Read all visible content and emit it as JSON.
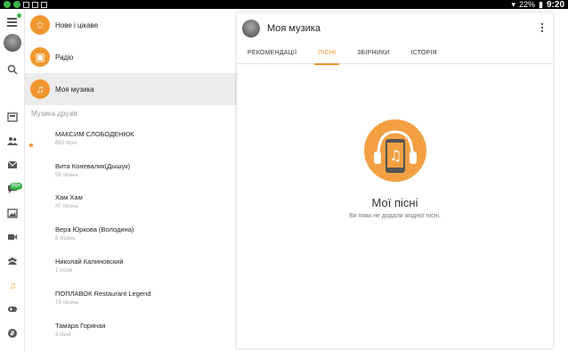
{
  "status_bar": {
    "battery": "22%",
    "time": "9:20"
  },
  "rail": {
    "icons": [
      "menu-icon",
      "avatar",
      "search-icon",
      "feed-icon",
      "friends-icon",
      "messages-icon",
      "chat-icon",
      "photos-icon",
      "video-icon",
      "groups-icon",
      "music-icon",
      "games-icon",
      "money-icon"
    ],
    "chat_badge": "99+"
  },
  "menu": {
    "items": [
      {
        "label": "Нове і цікаве",
        "icon": "star-icon"
      },
      {
        "label": "Радіо",
        "icon": "radio-icon"
      },
      {
        "label": "Моя музика",
        "icon": "music-note-icon"
      }
    ]
  },
  "friends_section": "Музика друзів",
  "friends": [
    {
      "name": "МАКСИМ СЛОБОДЕНЮК",
      "count": "663 пісні"
    },
    {
      "name": "Вита Коневалик(Дышук)",
      "count": "58 пісень"
    },
    {
      "name": "Хам Хам",
      "count": "47 пісень"
    },
    {
      "name": "Вера Юркова (Володина)",
      "count": "8 пісень"
    },
    {
      "name": "Николай Калиновский",
      "count": "1 пісня"
    },
    {
      "name": "ПОПЛАВОК Restaurant Legend",
      "count": "79 пісень"
    },
    {
      "name": "Тамара Горяная",
      "count": "3 пісні"
    }
  ],
  "panel": {
    "title": "Моя музика",
    "tabs": [
      "РЕКОМЕНДАЦІЇ",
      "ПІСНІ",
      "ЗБІРНИКИ",
      "ІСТОРІЯ"
    ],
    "active_tab": "ПІСНІ",
    "empty_title": "Мої пісні",
    "empty_subtitle": "Ви поки не додали жодної пісні."
  },
  "colors": {
    "accent": "#f0962e",
    "online": "#3bb34a"
  }
}
